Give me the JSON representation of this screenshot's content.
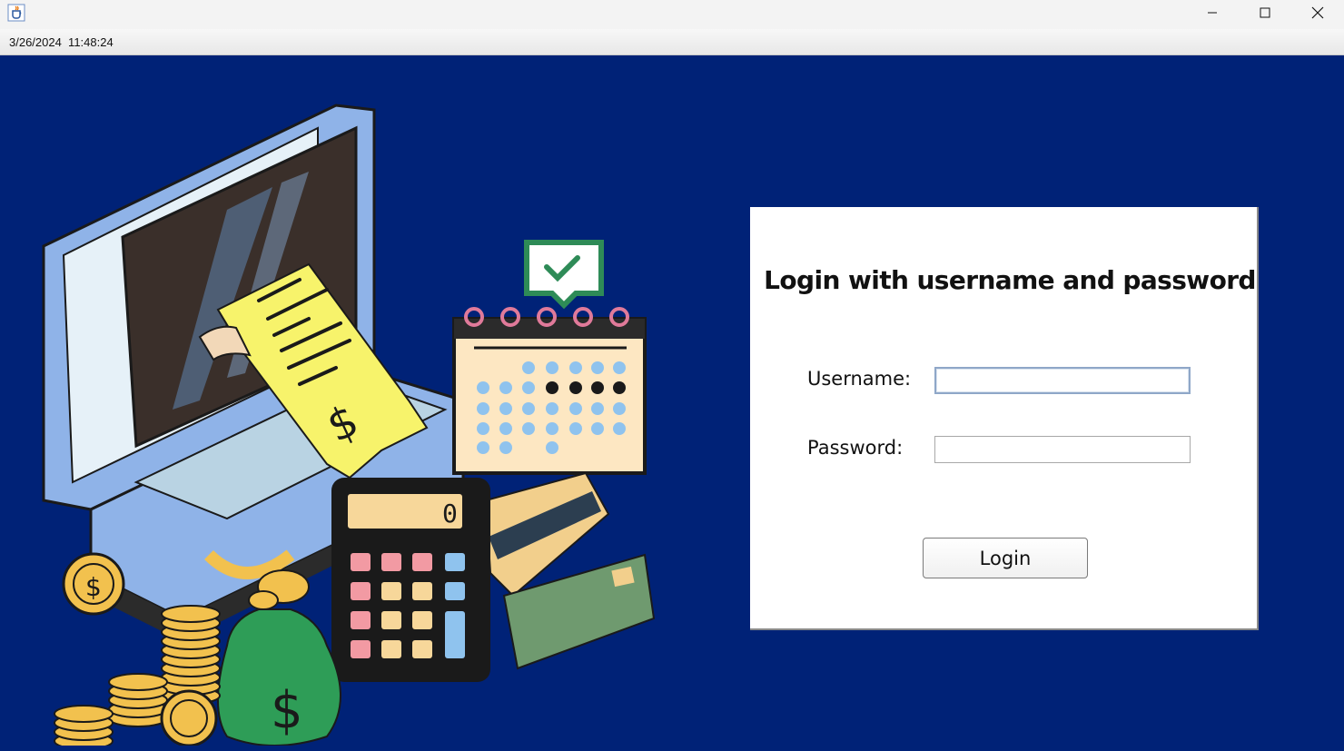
{
  "window": {
    "app_icon": "java-cup-icon",
    "controls": [
      "minimize-icon",
      "maximize-icon",
      "close-icon"
    ]
  },
  "statusbar": {
    "datetime": "3/26/2024  11:48:24"
  },
  "illustration": {
    "subject": "finance-illustration",
    "receipt_symbol": "$",
    "calculator_display": "0",
    "money_bag_symbol": "$",
    "coin_symbol": "$"
  },
  "login": {
    "title": "Login with username and password",
    "username_label": "Username:",
    "username_value": "",
    "password_label": "Password:",
    "password_value": "",
    "button_label": "Login"
  },
  "colors": {
    "background": "#002277",
    "panel": "#ffffff"
  }
}
